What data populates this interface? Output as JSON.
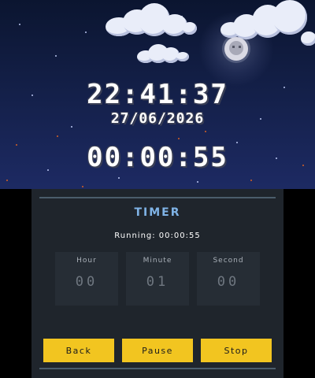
{
  "top_screen": {
    "clock_time": "22:41:37",
    "clock_date": "27/06/2026",
    "elapsed": "00:00:55"
  },
  "bottom_screen": {
    "title": "TIMER",
    "status": "Running: 00:00:55",
    "fields": [
      {
        "label": "Hour",
        "value": "00"
      },
      {
        "label": "Minute",
        "value": "01"
      },
      {
        "label": "Second",
        "value": "00"
      }
    ],
    "buttons": {
      "back": "Back",
      "pause": "Pause",
      "stop": "Stop"
    }
  },
  "colors": {
    "sky_top": "#0b1530",
    "sky_bottom": "#1d2a63",
    "panel": "#1f252c",
    "accent_title": "#7fb3e6",
    "button": "#f2c520"
  },
  "icons": {
    "moon": "moon-icon"
  }
}
